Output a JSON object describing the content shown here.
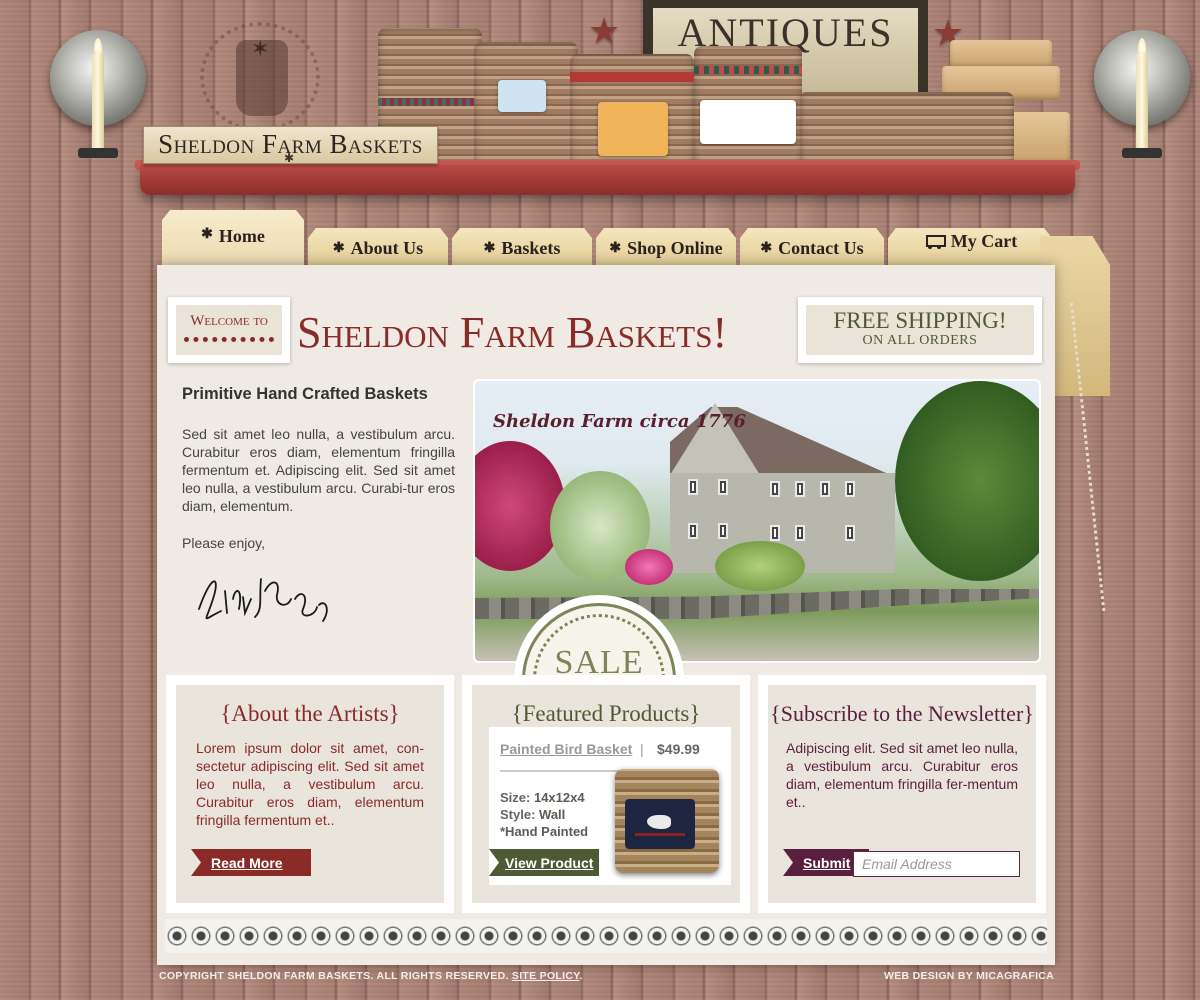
{
  "brand": {
    "sign_text": "Sheldon Farm Baskets",
    "antiques_sign": "ANTIQUES"
  },
  "nav": {
    "tabs": [
      {
        "label": "Home",
        "icon": "star-bullet"
      },
      {
        "label": "About Us",
        "icon": "star-bullet"
      },
      {
        "label": "Baskets",
        "icon": "star-bullet"
      },
      {
        "label": "Shop Online",
        "icon": "star-bullet"
      },
      {
        "label": "Contact Us",
        "icon": "star-bullet"
      },
      {
        "label": "My Cart",
        "icon": "cart-icon"
      }
    ]
  },
  "welcome": {
    "prefix": "Welcome to",
    "title": "Sheldon Farm Baskets!"
  },
  "shipping": {
    "line1": "FREE SHIPPING!",
    "line2": "ON ALL ORDERS"
  },
  "intro": {
    "heading": "Primitive Hand Crafted  Baskets",
    "text": "Sed sit amet leo nulla, a vestibulum arcu. Curabitur eros diam, elementum fringilla fermentum et. Adipiscing elit. Sed sit amet leo nulla, a vestibulum arcu. Curabi-tur eros diam, elementum.",
    "closing": "Please enjoy,"
  },
  "hero": {
    "caption": "Sheldon Farm circa 1776",
    "badge": "SALE"
  },
  "about": {
    "title": "{About the Artists}",
    "text": "Lorem ipsum dolor sit amet, con-sectetur adipiscing elit. Sed sit amet leo nulla, a vestibulum arcu. Curabitur eros diam, elementum fringilla fermentum et..",
    "button": "Read More"
  },
  "featured": {
    "title": "{Featured Products}",
    "product_name": "Painted Bird Basket",
    "separator": "|",
    "price": "$49.99",
    "size_label": "Size:",
    "size_value": "14x12x4",
    "style_label": "Style:",
    "style_value": "Wall",
    "note": "*Hand Painted",
    "button": "View Product"
  },
  "newsletter": {
    "title": "{Subscribe to the Newsletter}",
    "text": "Adipiscing elit. Sed sit amet leo nulla, a vestibulum arcu. Curabitur eros diam, elementum fringilla fer-mentum et..",
    "button": "Submit",
    "placeholder": "Email Address"
  },
  "footer": {
    "copyright": "COPYRIGHT SHELDON FARM BASKETS.  ALL RIGHTS RESERVED.",
    "policy_link": "SITE POLICY",
    "period": ".",
    "credit": "WEB DESIGN BY MICAGRAFICA"
  },
  "colors": {
    "burgundy": "#8b2b27",
    "olive": "#4e5a33",
    "plum": "#5a1f3f",
    "wood": "#a57d70"
  }
}
